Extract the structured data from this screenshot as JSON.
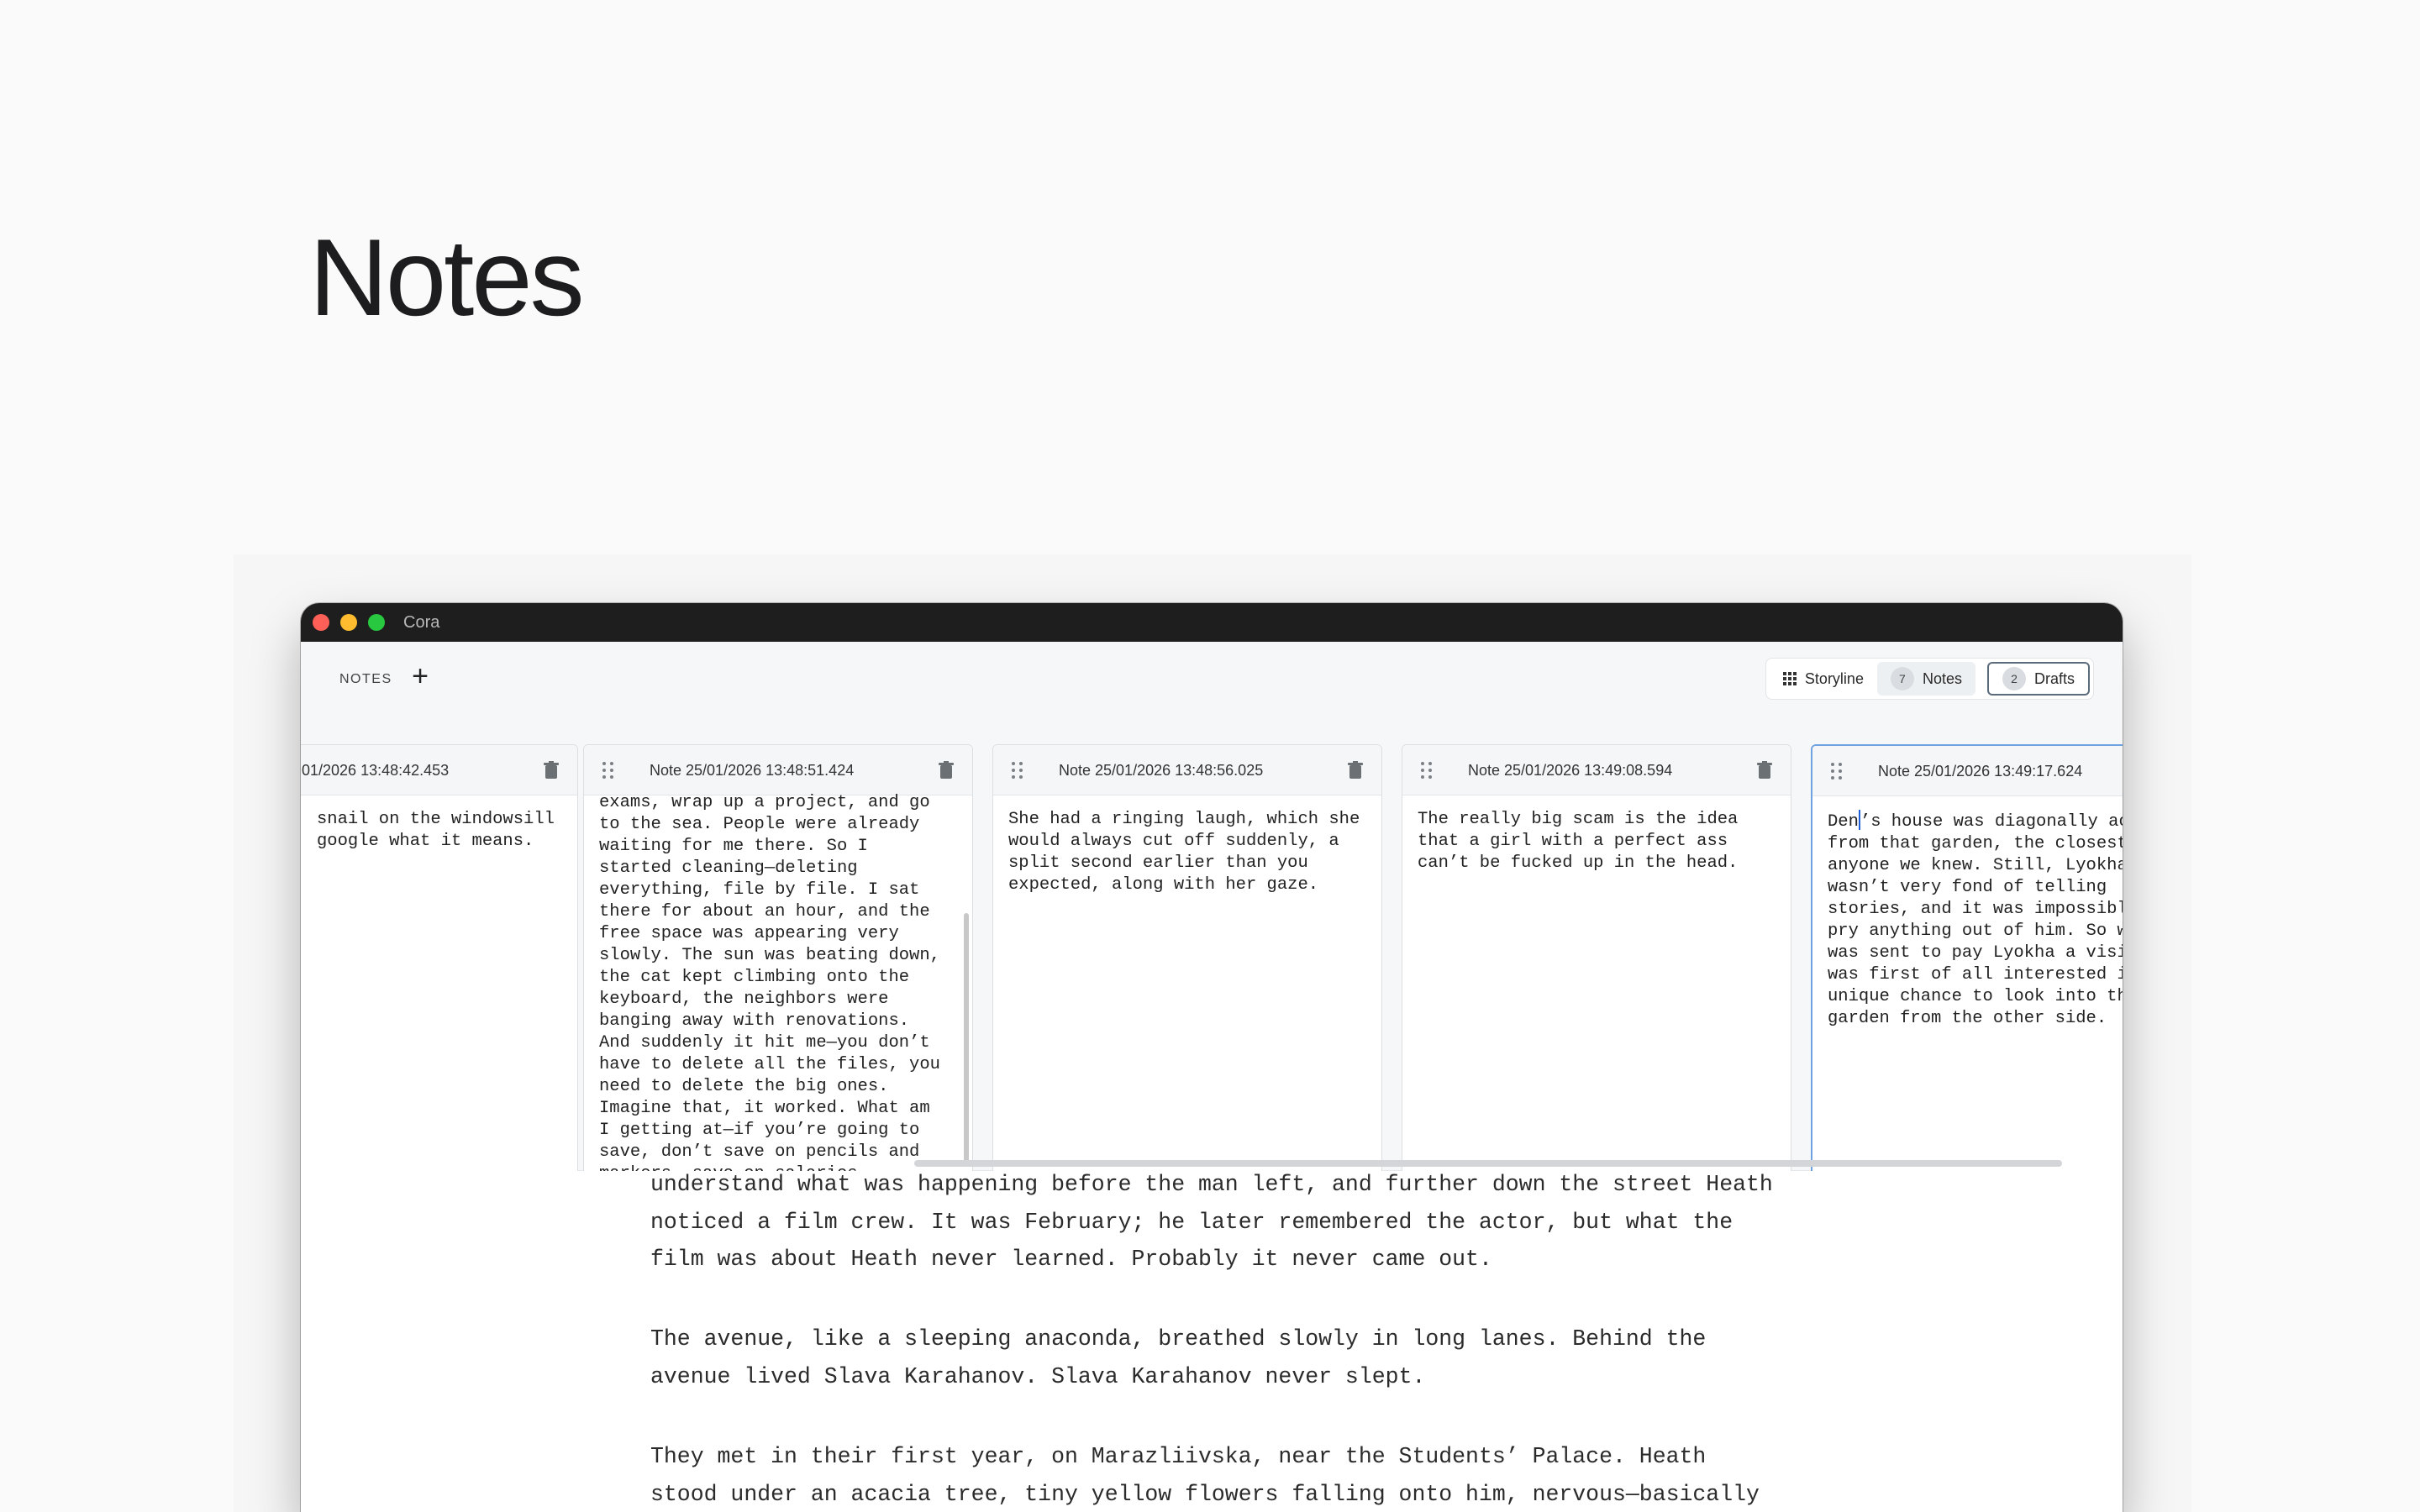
{
  "hero": {
    "title": "Notes"
  },
  "window": {
    "app_title": "Cora"
  },
  "panel": {
    "label": "NOTES",
    "add_icon": "+",
    "switcher": {
      "storyline_label": "Storyline",
      "notes_count": "7",
      "notes_label": "Notes",
      "drafts_count": "2",
      "drafts_label": "Drafts"
    }
  },
  "notes": [
    {
      "title": "01/2026 13:48:42.453",
      "body": "snail on the windowsill\ngoogle what it means."
    },
    {
      "title": "Note 25/01/2026 13:48:51.424",
      "body": "exams, wrap up a project, and go\nto the sea. People were already\nwaiting for me there. So I\nstarted cleaning—deleting\neverything, file by file. I sat\nthere for about an hour, and the\nfree space was appearing very\nslowly. The sun was beating down,\nthe cat kept climbing onto the\nkeyboard, the neighbors were\nbanging away with renovations.\nAnd suddenly it hit me—you don’t\nhave to delete all the files, you\nneed to delete the big ones.\nImagine that, it worked. What am\nI getting at—if you’re going to\nsave, don’t save on pencils and\nmarkers, save on salaries."
    },
    {
      "title": "Note 25/01/2026 13:48:56.025",
      "body": "She had a ringing laugh, which she\nwould always cut off suddenly, a\nsplit second earlier than you\nexpected, along with her gaze."
    },
    {
      "title": "Note 25/01/2026 13:49:08.594",
      "body": "The really big scam is the idea\nthat a girl with a perfect ass\ncan’t be fucked up in the head."
    },
    {
      "title": "Note 25/01/2026 13:49:17.624",
      "body_first": "Den",
      "body_rest": "’s house was diagonally ac\nfrom that garden, the closest\nanyone we knew. Still, Lyokha\nwasn’t very fond of telling\nstories, and it was impossibl\npry anything out of him. So w\nwas sent to pay Lyokha a visi\nwas first of all interested i\nunique chance to look into th\ngarden from the other side."
    }
  ],
  "editor": {
    "paragraphs": [
      "understand what was happening before the man left, and further down the street Heath\nnoticed a film crew. It was February; he later remembered the actor, but what the\nfilm was about Heath never learned. Probably it never came out.",
      "The avenue, like a sleeping anaconda, breathed slowly in long lanes. Behind the\navenue lived Slava Karahanov. Slava Karahanov never slept.",
      "They met in their first year, on Marazliivska, near the Students’ Palace. Heath\nstood under an acacia tree, tiny yellow flowers falling onto him, nervous—basically"
    ]
  }
}
